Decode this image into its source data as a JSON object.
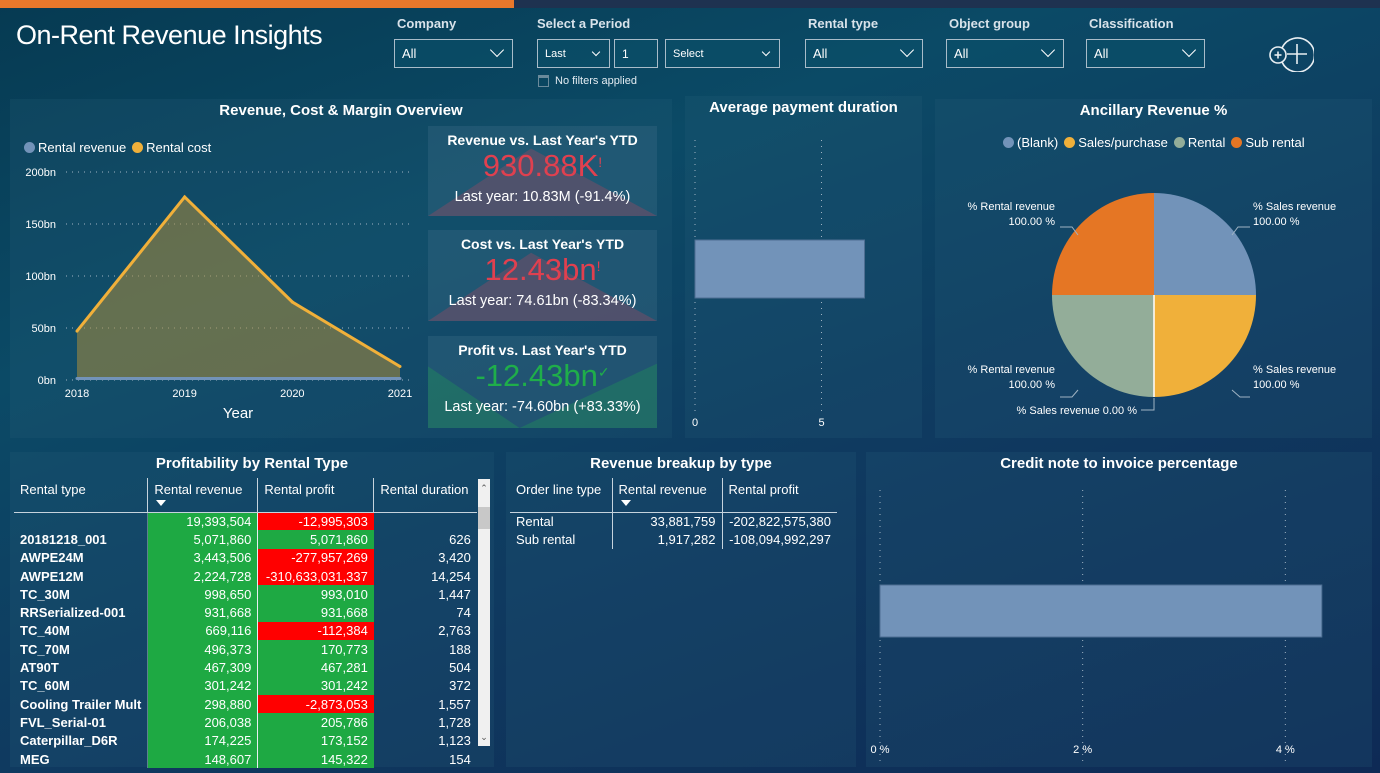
{
  "header": {
    "title": "On-Rent Revenue Insights",
    "filters": {
      "company": {
        "label": "Company",
        "value": "All"
      },
      "period": {
        "label": "Select a Period",
        "relative": "Last",
        "count": "1",
        "unit": "Select",
        "status": "No filters applied"
      },
      "rental_type": {
        "label": "Rental type",
        "value": "All"
      },
      "object_group": {
        "label": "Object group",
        "value": "All"
      },
      "classification": {
        "label": "Classification",
        "value": "All"
      }
    },
    "add_button_icon": "add-circle-icon"
  },
  "colors": {
    "accent_orange": "#e8782b",
    "revenue_blue": "#7293b9",
    "cost_yellow": "#f0b03a",
    "sage": "#93ad99",
    "positive_green": "#1ea943",
    "negative_red": "#ff0000",
    "kpi_red": "#e0404f",
    "kpi_green": "#1fae4a"
  },
  "overview": {
    "title": "Revenue, Cost & Margin Overview"
  },
  "kpis": [
    {
      "title": "Revenue vs. Last Year's YTD",
      "value": "930.88K",
      "status": "!",
      "status_icon": "alert-icon",
      "sub": "Last year: 10.83M (-91.4%)",
      "tone": "negative"
    },
    {
      "title": "Cost vs. Last Year's YTD",
      "value": "12.43bn",
      "status": "!",
      "status_icon": "alert-icon",
      "sub": "Last year: 74.61bn (-83.34%)",
      "tone": "negative"
    },
    {
      "title": "Profit vs. Last Year's YTD",
      "value": "-12.43bn",
      "status": "✓",
      "status_icon": "check-icon",
      "sub": "Last year: -74.60bn (+83.33%)",
      "tone": "positive"
    }
  ],
  "profitability": {
    "title": "Profitability by Rental Type",
    "columns": [
      "Rental type",
      "Rental revenue",
      "Rental profit",
      "Rental duration"
    ],
    "rows": [
      {
        "type": "",
        "revenue": "19,393,504",
        "profit": "-12,995,303",
        "duration": "",
        "profit_neg": true
      },
      {
        "type": "20181218_001",
        "revenue": "5,071,860",
        "profit": "5,071,860",
        "duration": "626",
        "profit_neg": false
      },
      {
        "type": "AWPE24M",
        "revenue": "3,443,506",
        "profit": "-277,957,269",
        "duration": "3,420",
        "profit_neg": true
      },
      {
        "type": "AWPE12M",
        "revenue": "2,224,728",
        "profit": "-310,633,031,337",
        "duration": "14,254",
        "profit_neg": true
      },
      {
        "type": "TC_30M",
        "revenue": "998,650",
        "profit": "993,010",
        "duration": "1,447",
        "profit_neg": false
      },
      {
        "type": "RRSerialized-001",
        "revenue": "931,668",
        "profit": "931,668",
        "duration": "74",
        "profit_neg": false
      },
      {
        "type": "TC_40M",
        "revenue": "669,116",
        "profit": "-112,384",
        "duration": "2,763",
        "profit_neg": true
      },
      {
        "type": "TC_70M",
        "revenue": "496,373",
        "profit": "170,773",
        "duration": "188",
        "profit_neg": false
      },
      {
        "type": "AT90T",
        "revenue": "467,309",
        "profit": "467,281",
        "duration": "504",
        "profit_neg": false
      },
      {
        "type": "TC_60M",
        "revenue": "301,242",
        "profit": "301,242",
        "duration": "372",
        "profit_neg": false
      },
      {
        "type": "Cooling Trailer Mult",
        "revenue": "298,880",
        "profit": "-2,873,053",
        "duration": "1,557",
        "profit_neg": true
      },
      {
        "type": "FVL_Serial-01",
        "revenue": "206,038",
        "profit": "205,786",
        "duration": "1,728",
        "profit_neg": false
      },
      {
        "type": "Caterpillar_D6R",
        "revenue": "174,225",
        "profit": "173,152",
        "duration": "1,123",
        "profit_neg": false
      },
      {
        "type": "MEG",
        "revenue": "148,607",
        "profit": "145,322",
        "duration": "154",
        "profit_neg": false
      }
    ]
  },
  "breakup": {
    "title": "Revenue breakup by type",
    "columns": [
      "Order line type",
      "Rental revenue",
      "Rental profit"
    ],
    "rows": [
      {
        "type": "Rental",
        "revenue": "33,881,759",
        "profit": "-202,822,575,380"
      },
      {
        "type": "Sub rental",
        "revenue": "1,917,282",
        "profit": "-108,094,992,297"
      }
    ]
  },
  "chart_data": [
    {
      "type": "area",
      "title": "Revenue, Cost & Margin Overview",
      "xlabel": "Year",
      "ylabel": "",
      "x": [
        "2018",
        "2019",
        "2020",
        "2021"
      ],
      "series": [
        {
          "name": "Rental revenue",
          "color": "#7293b9",
          "values": [
            0.5,
            0.5,
            0.5,
            0.5
          ]
        },
        {
          "name": "Rental cost",
          "color": "#f0b03a",
          "values": [
            47,
            176,
            75,
            13
          ]
        }
      ],
      "ylim": [
        0,
        200
      ],
      "yticks": [
        "0bn",
        "50bn",
        "100bn",
        "150bn",
        "200bn"
      ],
      "ytick_values": [
        0,
        50,
        100,
        150,
        200
      ],
      "legend": "top-left",
      "grid": true
    },
    {
      "type": "bar",
      "orientation": "horizontal",
      "title": "Average payment duration",
      "categories": [
        ""
      ],
      "values": [
        6.7
      ],
      "xlim": [
        0,
        8.3
      ],
      "xticks": [
        "0",
        "5"
      ],
      "xtick_values": [
        0,
        5
      ],
      "grid": true
    },
    {
      "type": "pie",
      "title": "Ancillary Revenue %",
      "legend_entries": [
        {
          "name": "(Blank)",
          "color": "#7293b9"
        },
        {
          "name": "Sales/purchase",
          "color": "#f0b03a"
        },
        {
          "name": "Rental",
          "color": "#93ad99"
        },
        {
          "name": "Sub rental",
          "color": "#e57624"
        }
      ],
      "slices": [
        {
          "category": "(Blank)",
          "measure": "% Sales revenue",
          "value": 100.0,
          "label": "% Sales revenue\n100.00 %",
          "color": "#7293b9"
        },
        {
          "category": "Sales/purchase",
          "measure": "% Sales revenue",
          "value": 100.0,
          "label": "% Sales revenue\n100.00 %",
          "color": "#f0b03a"
        },
        {
          "category": "Rental",
          "measure": "% Sales revenue",
          "value": 0.0,
          "label": "% Sales revenue 0.00 %",
          "color": "#ffffff"
        },
        {
          "category": "Rental",
          "measure": "% Rental revenue",
          "value": 100.0,
          "label": "% Rental revenue\n100.00 %",
          "color": "#93ad99"
        },
        {
          "category": "Sub rental",
          "measure": "% Rental revenue",
          "value": 100.0,
          "label": "% Rental revenue\n100.00 %",
          "color": "#e57624"
        }
      ],
      "legend": "top"
    },
    {
      "type": "bar",
      "orientation": "horizontal",
      "title": "Credit note to invoice percentage",
      "categories": [
        ""
      ],
      "values": [
        4.36
      ],
      "xlim": [
        0,
        5.25
      ],
      "xticks": [
        "0 %",
        "2 %",
        "4 %"
      ],
      "xtick_values": [
        0,
        2,
        4
      ],
      "grid": true
    }
  ]
}
